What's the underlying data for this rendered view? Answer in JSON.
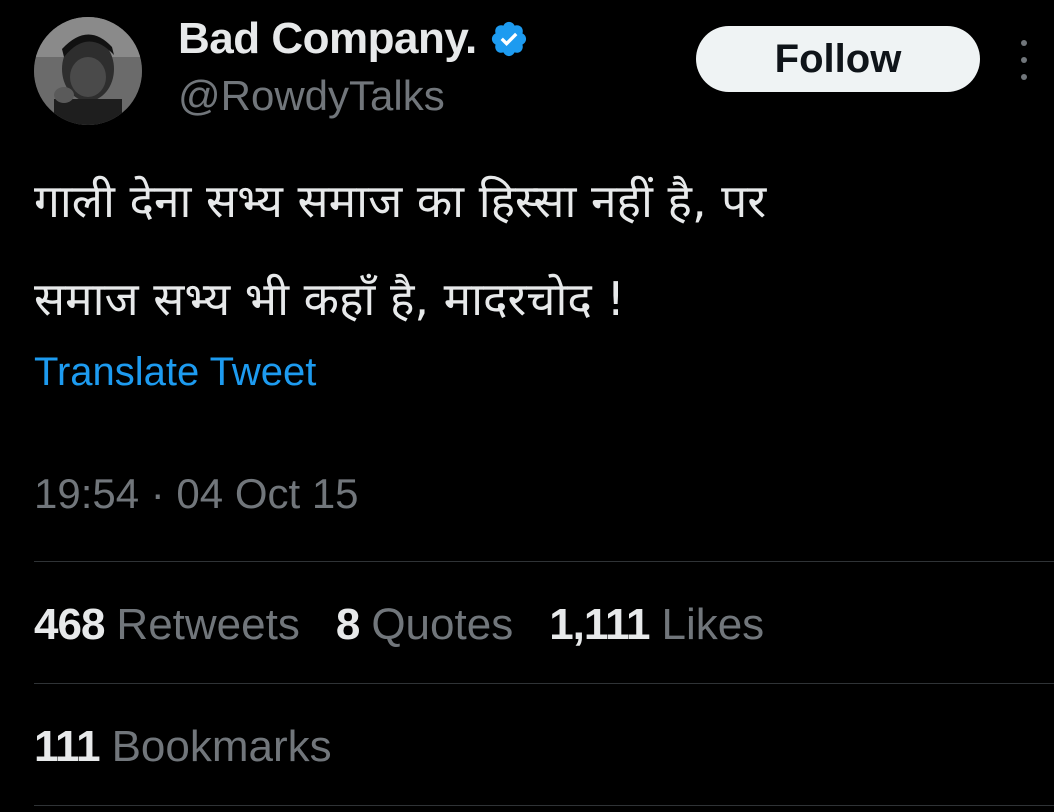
{
  "author": {
    "display_name": "Bad Company.",
    "handle": "@RowdyTalks",
    "verified_icon": "verified-badge-icon",
    "verified_color": "#1d9bf0",
    "avatar": "user-avatar-photo"
  },
  "actions": {
    "follow_label": "Follow",
    "more_icon": "more-vertical-icon"
  },
  "tweet": {
    "text_lines": [
      "गाली देना सभ्य समाज का हिस्सा नहीं है, पर",
      "समाज सभ्य भी कहाँ है, मादरचोद !"
    ],
    "translate_label": "Translate Tweet",
    "timestamp": "19:54 · 04 Oct 15"
  },
  "stats": {
    "retweets": {
      "count": "468",
      "label": "Retweets"
    },
    "quotes": {
      "count": "8",
      "label": "Quotes"
    },
    "likes": {
      "count": "1,111",
      "label": "Likes"
    },
    "bookmarks": {
      "count": "111",
      "label": "Bookmarks"
    }
  },
  "colors": {
    "background": "#000000",
    "text_primary": "#e7e9ea",
    "text_secondary": "#71767b",
    "link": "#1d9bf0",
    "divider": "#2f3336",
    "follow_button_bg": "#eff3f4"
  }
}
